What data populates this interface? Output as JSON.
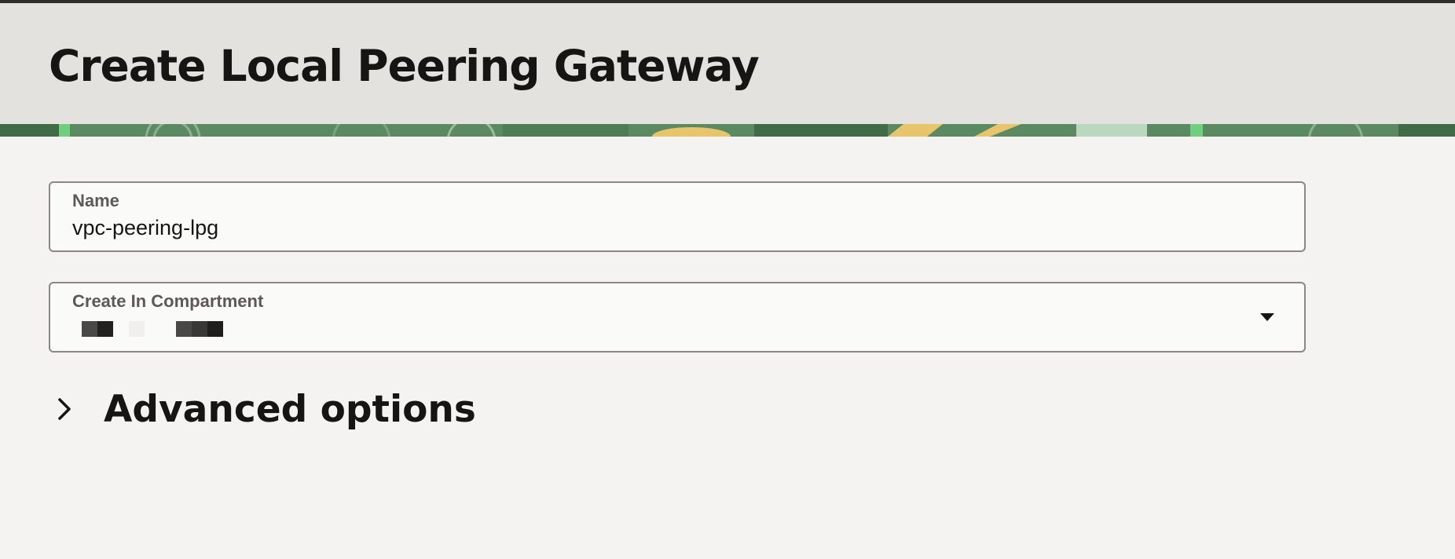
{
  "header": {
    "title": "Create Local Peering Gateway"
  },
  "form": {
    "name": {
      "label": "Name",
      "value": "vpc-peering-lpg"
    },
    "compartment": {
      "label": "Create In Compartment",
      "value_redacted": true
    },
    "advanced": {
      "label": "Advanced options",
      "icon": "chevron-right-icon"
    }
  },
  "colors": {
    "header_bg": "#e4e2de",
    "page_bg": "#f4f3f1",
    "banner_green": "#5b8a62",
    "banner_yellow": "#e8c46a",
    "text": "#161513"
  }
}
